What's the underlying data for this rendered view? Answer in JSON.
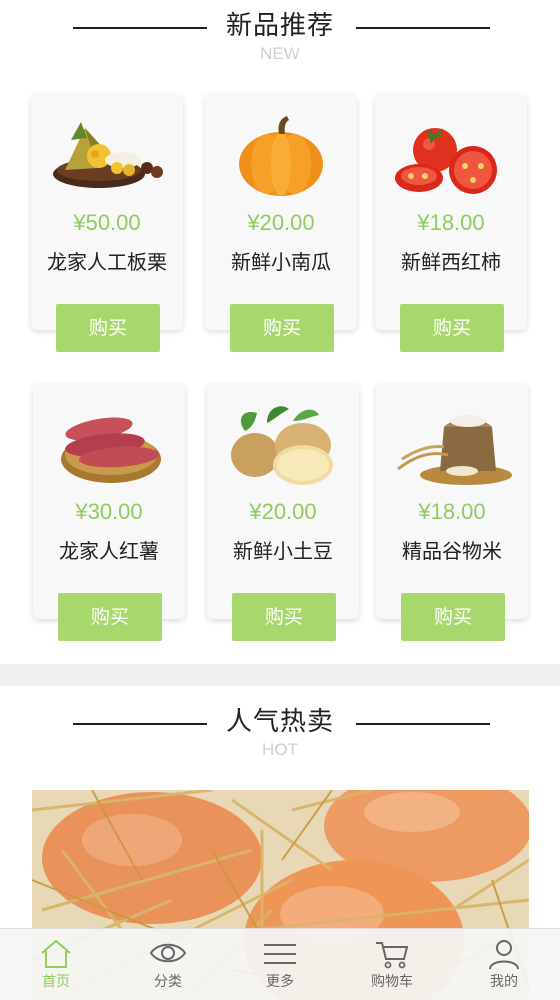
{
  "new_section": {
    "title": "新品推荐",
    "subtitle": "NEW"
  },
  "products": [
    {
      "price": "¥50.00",
      "name": "龙家人工板栗",
      "buy_label": "购买",
      "image_icon": "zongzi-chestnut-image"
    },
    {
      "price": "¥20.00",
      "name": "新鲜小南瓜",
      "buy_label": "购买",
      "image_icon": "pumpkin-image"
    },
    {
      "price": "¥18.00",
      "name": "新鲜西红柿",
      "buy_label": "购买",
      "image_icon": "tomato-image"
    },
    {
      "price": "¥30.00",
      "name": "龙家人红薯",
      "buy_label": "购买",
      "image_icon": "sweet-potato-image"
    },
    {
      "price": "¥20.00",
      "name": "新鲜小土豆",
      "buy_label": "购买",
      "image_icon": "potato-image"
    },
    {
      "price": "¥18.00",
      "name": "精品谷物米",
      "buy_label": "购买",
      "image_icon": "grain-rice-image"
    }
  ],
  "hot_section": {
    "title": "人气热卖",
    "subtitle": "HOT",
    "banner_icon": "eggs-in-straw-image"
  },
  "tabbar": {
    "items": [
      {
        "label": "首页",
        "icon": "home-icon",
        "active": true
      },
      {
        "label": "分类",
        "icon": "eye-icon",
        "active": false
      },
      {
        "label": "更多",
        "icon": "menu-icon",
        "active": false
      },
      {
        "label": "购物车",
        "icon": "cart-icon",
        "active": false
      },
      {
        "label": "我的",
        "icon": "user-icon",
        "active": false
      }
    ]
  },
  "colors": {
    "accent": "#8fce5d",
    "button": "#a7d76d",
    "card_bg": "#f8f8f8"
  }
}
